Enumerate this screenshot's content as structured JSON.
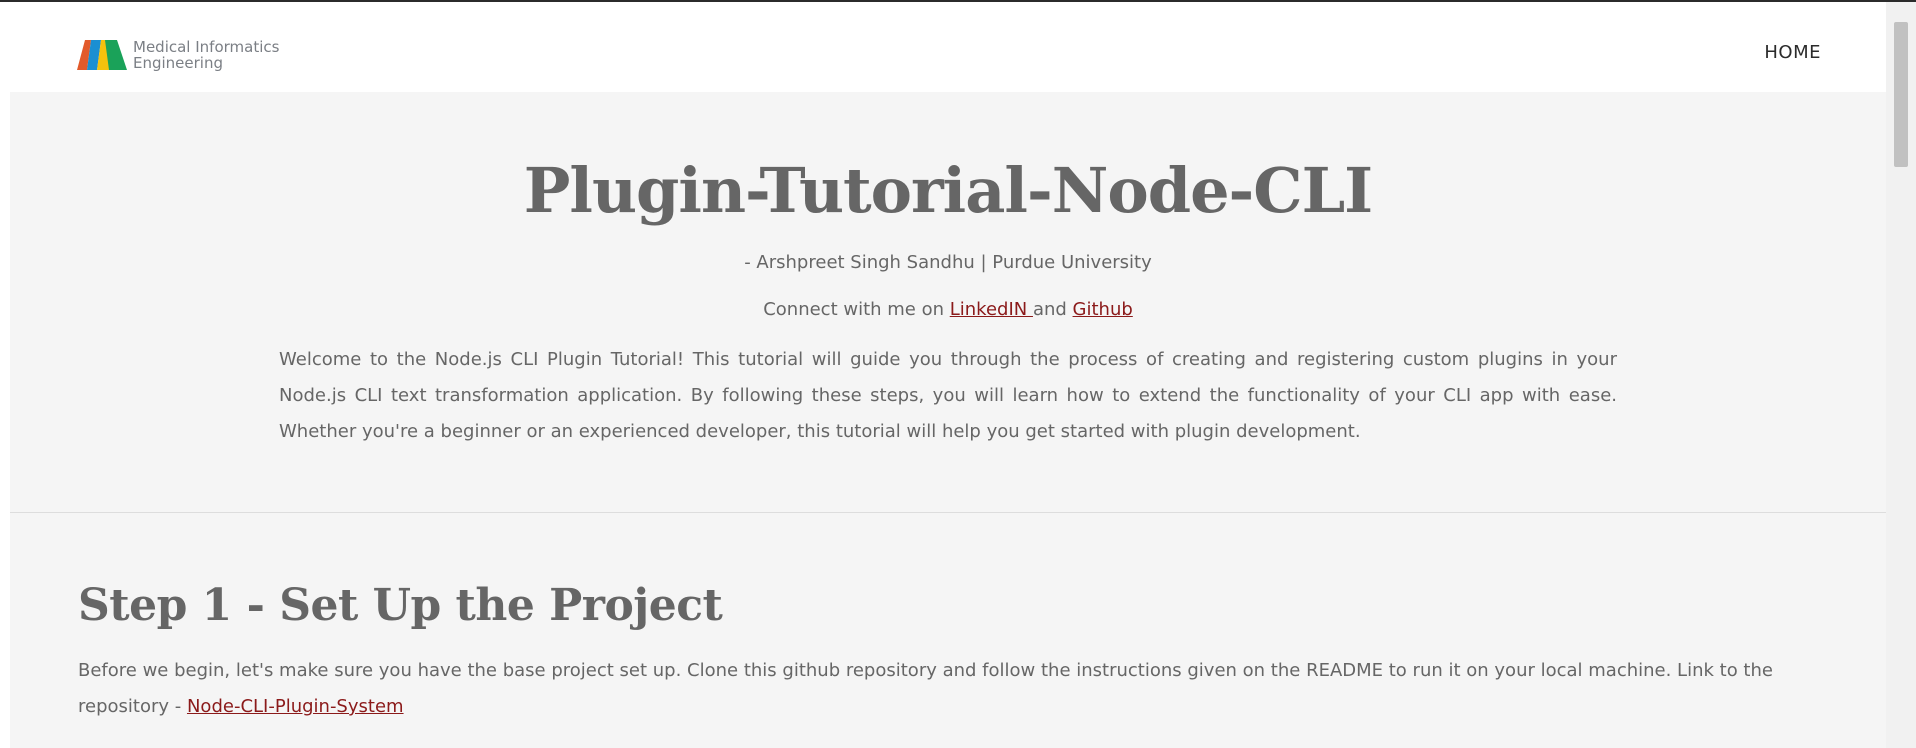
{
  "header": {
    "logo_text_line1": "Medical Informatics",
    "logo_text_line2": "Engineering",
    "nav_home": "HOME",
    "logo_colors": [
      "#e25a2b",
      "#1b8fd2",
      "#f4c20d",
      "#1aa259"
    ]
  },
  "hero": {
    "title": "Plugin-Tutorial-Node-CLI",
    "author": "- Arshpreet Singh Sandhu | Purdue University",
    "connect_prefix": "Connect with me on ",
    "linkedin_label": "LinkedIN ",
    "connect_and": "and ",
    "github_label": "Github",
    "intro": "Welcome to the Node.js CLI Plugin Tutorial! This tutorial will guide you through the process of creating and registering custom plugins in your Node.js CLI text transformation application. By following these steps, you will learn how to extend the functionality of your CLI app with ease. Whether you're a beginner or an experienced developer, this tutorial will help you get started with plugin development."
  },
  "step1": {
    "title": "Step 1 - Set Up the Project",
    "text": "Before we begin, let's make sure you have the base project set up. Clone this github repository and follow the instructions given on the README to run it on your local machine. Link to the repository - ",
    "repo_link": "Node-CLI-Plugin-System"
  },
  "colors": {
    "link": "#8b1a1a",
    "section_bg": "#f5f5f5",
    "text": "#666666"
  }
}
